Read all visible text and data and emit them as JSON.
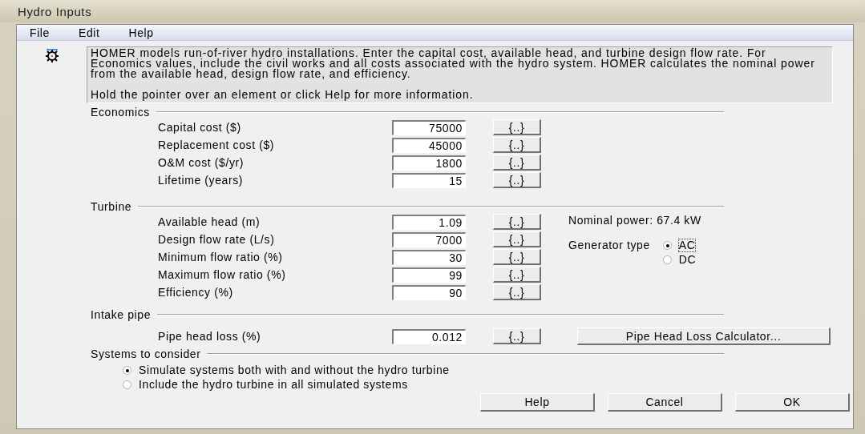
{
  "window": {
    "title": "Hydro Inputs"
  },
  "menu": [
    {
      "label": "File"
    },
    {
      "label": "Edit"
    },
    {
      "label": "Help"
    }
  ],
  "description": [
    "HOMER models run-of-river hydro installations. Enter the capital cost, available head, and turbine design flow rate.  For Economics values, include the civil works and all costs associated with the hydro system. HOMER calculates the nominal power from the available head, design flow rate, and efficiency.",
    "Hold the pointer over an element or click Help for more information."
  ],
  "economics": {
    "title": "Economics",
    "rows": [
      {
        "label": "Capital  cost ($)",
        "value": "75000",
        "button": "{..}"
      },
      {
        "label": "Replacement cost ($)",
        "value": "45000",
        "button": "{..}"
      },
      {
        "label": "O&M cost ($/yr)",
        "value": "1800",
        "button": "{..}"
      },
      {
        "label": "Lifetime (years)",
        "value": "15",
        "button": "{..}"
      }
    ]
  },
  "turbine": {
    "title": "Turbine",
    "rows": [
      {
        "label": "Available head (m)",
        "value": "1.09",
        "button": "{..}"
      },
      {
        "label": "Design flow rate (L/s)",
        "value": "7000",
        "button": "{..}"
      },
      {
        "label": "Minimum flow ratio (%)",
        "value": "30",
        "button": "{..}"
      },
      {
        "label": "Maximum flow ratio (%)",
        "value": "99",
        "button": "{..}"
      },
      {
        "label": "Efficiency (%)",
        "value": "90",
        "button": "{..}"
      }
    ],
    "nominal_power": "Nominal power: 67.4 kW",
    "generator_type": {
      "label": "Generator type",
      "options": [
        {
          "label": "AC",
          "selected": true,
          "focused": true
        },
        {
          "label": "DC",
          "selected": false,
          "focused": false
        }
      ]
    }
  },
  "intake_pipe": {
    "title": "Intake pipe",
    "rows": [
      {
        "label": "Pipe head loss (%)",
        "value": "0.012",
        "button": "{..}"
      }
    ],
    "calculator_button": "Pipe Head Loss Calculator..."
  },
  "systems": {
    "title": "Systems to consider",
    "options": [
      {
        "label": "Simulate systems both with and without the hydro turbine",
        "selected": true
      },
      {
        "label": "Include the hydro turbine in all simulated systems",
        "selected": false
      }
    ]
  },
  "buttons": [
    "Help",
    "Cancel",
    "OK"
  ]
}
